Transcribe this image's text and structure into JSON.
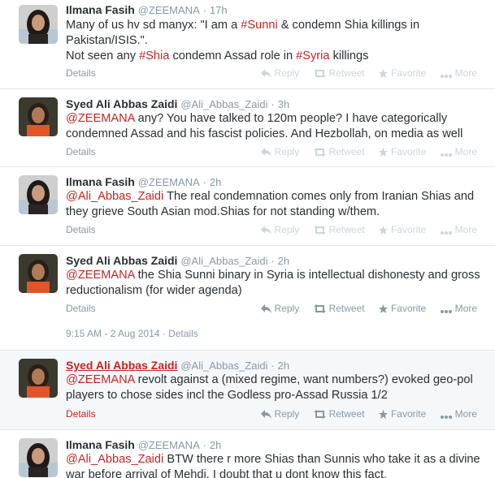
{
  "actions": {
    "reply": "Reply",
    "retweet": "Retweet",
    "favorite": "Favorite",
    "more": "More",
    "details": "Details"
  },
  "timestamp_text": "9:15 AM - 2 Aug 2014 · Details",
  "colors": {
    "link": "#cc2222",
    "muted": "#8899a6",
    "faint": "#ccd6dd",
    "divider": "#e1e8ed"
  },
  "tweets": [
    {
      "name": "Ilmana Fasih",
      "handle": "@ZEEMANA",
      "time": "17h",
      "lines": [
        [
          {
            "t": "Many of us hv sd manyx: \"I am a "
          },
          {
            "t": "#Sunni",
            "c": "ht"
          },
          {
            "t": " & condemn Shia killings in"
          }
        ],
        [
          {
            "t": "Pakistan/ISIS.\"."
          }
        ],
        [
          {
            "t": "Not seen any "
          },
          {
            "t": "#Shia",
            "c": "ht"
          },
          {
            "t": " condemn Assad role in "
          },
          {
            "t": "#Syria",
            "c": "ht"
          },
          {
            "t": " killings"
          }
        ]
      ]
    },
    {
      "name": "Syed Ali Abbas Zaidi",
      "handle": "@Ali_Abbas_Zaidi",
      "time": "3h",
      "lines": [
        [
          {
            "t": "@ZEEMANA",
            "c": "mention"
          },
          {
            "t": " any? You have talked to 120m people? I have categorically"
          }
        ],
        [
          {
            "t": "condemned Assad and his fascist policies. And Hezbollah, on media as well"
          }
        ]
      ]
    },
    {
      "name": "Ilmana Fasih",
      "handle": "@ZEEMANA",
      "time": "2h",
      "lines": [
        [
          {
            "t": "@Ali_Abbas_Zaidi",
            "c": "mention"
          },
          {
            "t": " The real condemnation comes only from Iranian Shias and"
          }
        ],
        [
          {
            "t": "they grieve South Asian  mod.Shias for not standing w/them."
          }
        ]
      ]
    },
    {
      "name": "Syed Ali Abbas Zaidi",
      "handle": "@Ali_Abbas_Zaidi",
      "time": "2h",
      "lines": [
        [
          {
            "t": "@ZEEMANA",
            "c": "mention"
          },
          {
            "t": " the Shia Sunni binary in Syria is intellectual dishonesty and gross"
          }
        ],
        [
          {
            "t": "reductionalism (for wider agenda)"
          }
        ]
      ]
    },
    {
      "name": "Syed Ali Abbas Zaidi",
      "handle": "@Ali_Abbas_Zaidi",
      "time": "2h",
      "lines": [
        [
          {
            "t": "@ZEEMANA",
            "c": "mention"
          },
          {
            "t": " revolt against a (mixed regime, want numbers?) evoked geo-pol"
          }
        ],
        [
          {
            "t": "players to chose sides incl the Godless pro-Assad Russia 1/2"
          }
        ]
      ]
    },
    {
      "name": "Ilmana Fasih",
      "handle": "@ZEEMANA",
      "time": "2h",
      "lines": [
        [
          {
            "t": "@Ali_Abbas_Zaidi",
            "c": "mention"
          },
          {
            "t": " BTW there r more Shias than Sunnis who take it as a divine"
          }
        ],
        [
          {
            "t": "war before arrival of Mehdi. I doubt that u dont know this fact."
          }
        ]
      ]
    }
  ]
}
